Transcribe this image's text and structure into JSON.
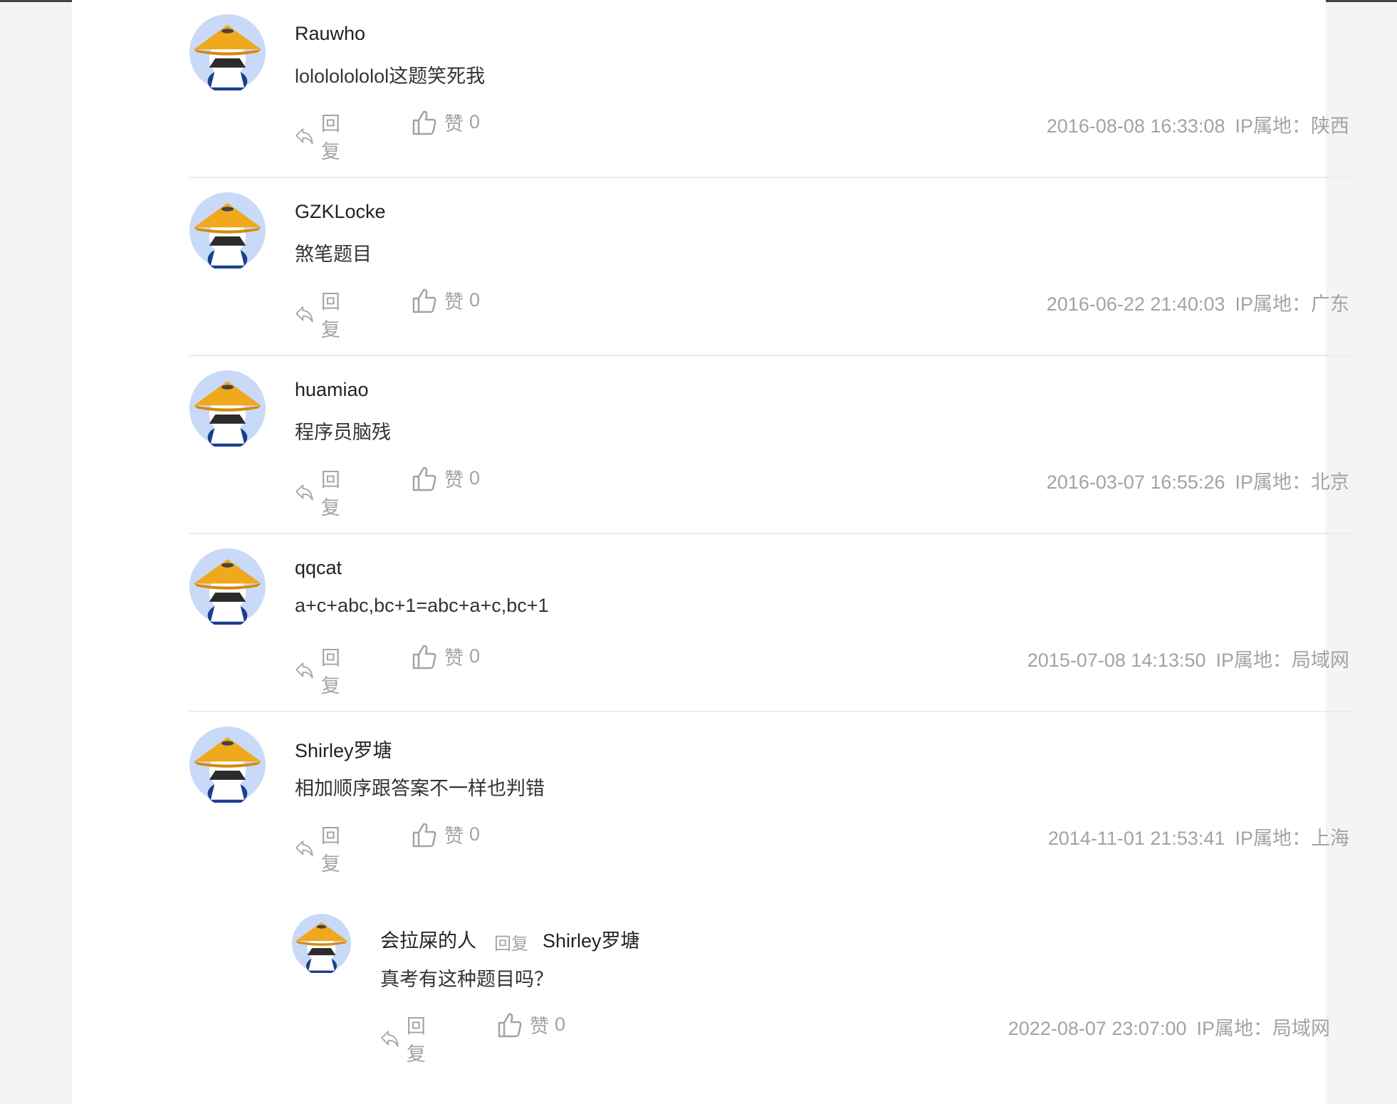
{
  "labels": {
    "reply": "回复",
    "like": "赞"
  },
  "comments": [
    {
      "user": "Rauwho",
      "text": "lolololololol这题笑死我",
      "likes": "0",
      "time": "2016-08-08 16:33:08",
      "ip": "IP属地：陕西"
    },
    {
      "user": "GZKLocke",
      "text": "煞笔题目",
      "likes": "0",
      "time": "2016-06-22 21:40:03",
      "ip": "IP属地：广东"
    },
    {
      "user": "huamiao",
      "text": "程序员脑残",
      "likes": "0",
      "time": "2016-03-07 16:55:26",
      "ip": "IP属地：北京"
    },
    {
      "user": "qqcat",
      "text": "a+c+abc,bc+1=abc+a+c,bc+1",
      "likes": "0",
      "time": "2015-07-08 14:13:50",
      "ip": "IP属地：局域网"
    },
    {
      "user": "Shirley罗塘",
      "text": "相加顺序跟答案不一样也判错",
      "likes": "0",
      "time": "2014-11-01 21:53:41",
      "ip": "IP属地：上海"
    }
  ],
  "reply": {
    "user": "会拉屎的人",
    "reply_word": "回复",
    "target": "Shirley罗塘",
    "text": "真考有这种题目吗？",
    "likes": "0",
    "time": "2022-08-07 23:07:00",
    "ip": "IP属地：局域网"
  },
  "icons": {
    "avatar": "bamboo-hat-avatar-icon",
    "reply": "reply-arrow-icon",
    "like": "thumbs-up-icon"
  },
  "colors": {
    "avatar_bg": "#c9daf8",
    "hat": "#f0a81c",
    "muted": "#a3a3a3",
    "divider": "#ececec"
  }
}
